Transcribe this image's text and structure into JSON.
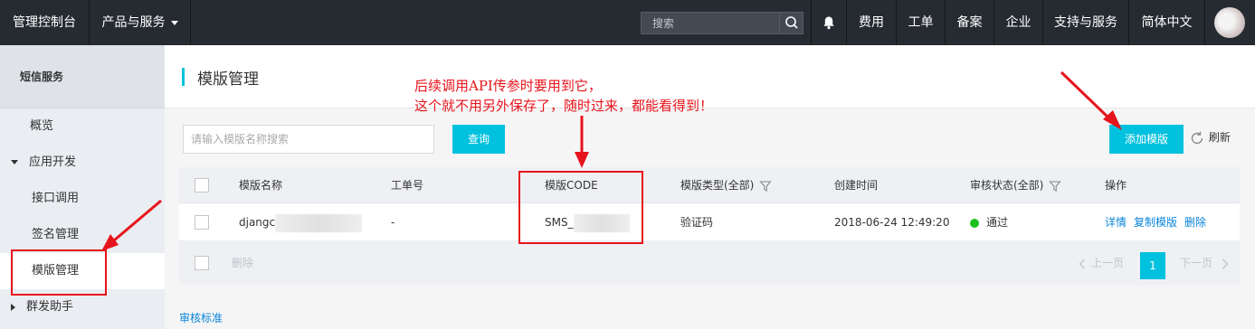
{
  "topbar": {
    "console_title": "管理控制台",
    "products_menu": "产品与服务",
    "search_placeholder": "搜索",
    "nav": [
      "费用",
      "工单",
      "备案",
      "企业",
      "支持与服务",
      "简体中文"
    ]
  },
  "sidebar": {
    "title": "短信服务",
    "items": {
      "overview": "概览",
      "app_dev": "应用开发",
      "api_call": "接口调用",
      "sign_mgmt": "签名管理",
      "template_mgmt": "模版管理",
      "bulk_helper": "群发助手"
    }
  },
  "main": {
    "title": "模版管理",
    "search_placeholder": "请输入模版名称搜索",
    "query_label": "查询",
    "add_label": "添加模版",
    "refresh_label": "刷新",
    "columns": {
      "name": "模版名称",
      "ticket": "工单号",
      "code": "模版CODE",
      "type": "模版类型(全部)",
      "created": "创建时间",
      "status": "审核状态(全部)",
      "actions": "操作"
    },
    "row": {
      "name": "djangc",
      "ticket": "-",
      "code": "SMS_",
      "type": "验证码",
      "created": "2018-06-24 12:49:20",
      "status": "通过",
      "action_detail": "详情",
      "action_copy": "复制模版",
      "action_delete": "删除"
    },
    "footer": {
      "delete_label": "删除",
      "prev_label": "上一页",
      "page": "1",
      "next_label": "下一页"
    },
    "audit_standard": "审核标准"
  },
  "annotation": {
    "line1": "后续调用API传参时要用到它，",
    "line2": "这个就不用另外保存了，随时过来，都能看得到！",
    "color": "#e6141c"
  },
  "colors": {
    "accent": "#00c1de",
    "topbar": "#262b32",
    "link": "#0a85d9",
    "status_ok": "#1dc11d"
  }
}
